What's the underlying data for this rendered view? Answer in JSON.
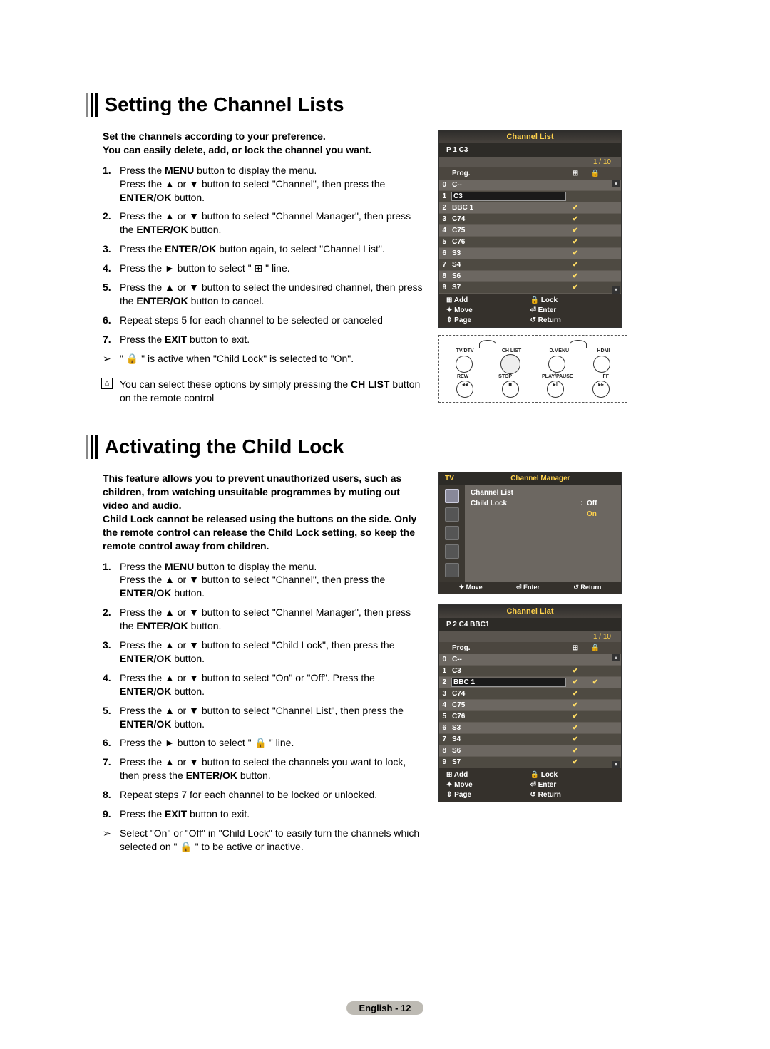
{
  "section1": {
    "title": "Setting the Channel Lists",
    "intro1": "Set the channels according to your preference.",
    "intro2": "You can easily delete, add, or lock the channel you want.",
    "s1a": "Press the ",
    "s1b": "MENU",
    "s1c": " button to display the menu.",
    "s1d": "Press the ▲ or ▼ button to select \"Channel\", then press the ",
    "s1e": "ENTER/OK",
    "s1f": " button.",
    "s2a": "Press the ▲ or ▼ button to select \"Channel Manager\", then press the ",
    "s2b": "ENTER/OK",
    "s2c": " button.",
    "s3a": "Press the ",
    "s3b": "ENTER/OK",
    "s3c": " button again, to select \"Channel List\".",
    "s4a": "Press the ► button to select \" ⊞ \" line.",
    "s5a": "Press the ▲ or ▼ button to select the undesired channel, then press the ",
    "s5b": "ENTER/OK",
    "s5c": " button to cancel.",
    "s6": "Repeat steps 5 for each channel to be selected or canceled",
    "s7a": "Press the ",
    "s7b": "EXIT",
    "s7c": " button to exit.",
    "note": "\" 🔒 \" is active when \"Child Lock\" is selected to \"On\".",
    "tipA": "You can select these options by simply pressing the ",
    "tipB": "CH LIST",
    "tipC": " button on the remote control"
  },
  "osd1": {
    "title": "Channel List",
    "sub": "P  1  C3",
    "counter": "1 / 10",
    "head_prog": "Prog.",
    "rows": [
      {
        "n": "0",
        "name": "C--",
        "add": "",
        "lock": ""
      },
      {
        "n": "1",
        "name": "C3",
        "add": "",
        "lock": ""
      },
      {
        "n": "2",
        "name": "BBC 1",
        "add": "✔",
        "lock": ""
      },
      {
        "n": "3",
        "name": "C74",
        "add": "✔",
        "lock": ""
      },
      {
        "n": "4",
        "name": "C75",
        "add": "✔",
        "lock": ""
      },
      {
        "n": "5",
        "name": "C76",
        "add": "✔",
        "lock": ""
      },
      {
        "n": "6",
        "name": "S3",
        "add": "✔",
        "lock": ""
      },
      {
        "n": "7",
        "name": "S4",
        "add": "✔",
        "lock": ""
      },
      {
        "n": "8",
        "name": "S6",
        "add": "✔",
        "lock": ""
      },
      {
        "n": "9",
        "name": "S7",
        "add": "✔",
        "lock": ""
      }
    ],
    "f_add": "⊞ Add",
    "f_lock": "🔒 Lock",
    "f_move": "✦ Move",
    "f_enter": "⏎ Enter",
    "f_page": "⇕ Page",
    "f_return": "↺ Return",
    "selected_row": 1
  },
  "remote": {
    "l1": [
      "TV/DTV",
      "CH LIST",
      "D.MENU",
      "HDMI"
    ],
    "l2": [
      "REW",
      "STOP",
      "PLAY/PAUSE",
      "FF"
    ]
  },
  "section2": {
    "title": "Activating the Child Lock",
    "intro1": "This feature allows you to prevent unauthorized users, such as children, from watching unsuitable programmes by muting out video and audio.",
    "intro2": "Child Lock cannot be released using the buttons on the side. Only the remote control can release the Child Lock setting, so keep the remote control away from children.",
    "s1a": "Press the ",
    "s1b": "MENU",
    "s1c": " button to display the menu.",
    "s1d": "Press the ▲ or ▼ button to select \"Channel\", then press the ",
    "s1e": "ENTER/OK",
    "s1f": " button.",
    "s2a": "Press the ▲ or ▼ button to select \"Channel Manager\", then press the ",
    "s2b": "ENTER/OK",
    "s2c": " button.",
    "s3a": "Press the ▲ or ▼ button to select \"Child Lock\", then press the ",
    "s3b": "ENTER/OK",
    "s3c": " button.",
    "s4a": "Press the ▲ or ▼ button to select \"On\" or \"Off\". Press the ",
    "s4b": "ENTER/OK",
    "s4c": " button.",
    "s5a": "Press the ▲ or ▼ button to select \"Channel List\", then press the ",
    "s5b": "ENTER/OK",
    "s5c": " button.",
    "s6": "Press the ► button to select \" 🔒 \" line.",
    "s7a": "Press the ▲ or ▼ button to select the channels you want to lock, then press the ",
    "s7b": "ENTER/OK",
    "s7c": " button.",
    "s8": "Repeat steps 7 for each channel to be locked or unlocked.",
    "s9a": "Press the ",
    "s9b": "EXIT",
    "s9c": " button to exit.",
    "note": "Select \"On\" or \"Off\" in \"Child Lock\" to easily turn the channels which selected on \" 🔒 \" to be active or inactive."
  },
  "osd_cm": {
    "tv": "TV",
    "title": "Channel Manager",
    "m1": "Channel List",
    "m2k": "Child Lock",
    "m2sep": ":",
    "m2v_off": "Off",
    "m2v_on": "On",
    "f_move": "✦ Move",
    "f_enter": "⏎ Enter",
    "f_return": "↺ Return"
  },
  "osd2": {
    "title": "Channel Liat",
    "sub": "P  2  C4      BBC1",
    "counter": "1 / 10",
    "head_prog": "Prog.",
    "rows": [
      {
        "n": "0",
        "name": "C--",
        "add": "",
        "lock": ""
      },
      {
        "n": "1",
        "name": "C3",
        "add": "✔",
        "lock": ""
      },
      {
        "n": "2",
        "name": "BBC 1",
        "add": "✔",
        "lock": "✔"
      },
      {
        "n": "3",
        "name": "C74",
        "add": "✔",
        "lock": ""
      },
      {
        "n": "4",
        "name": "C75",
        "add": "✔",
        "lock": ""
      },
      {
        "n": "5",
        "name": "C76",
        "add": "✔",
        "lock": ""
      },
      {
        "n": "6",
        "name": "S3",
        "add": "✔",
        "lock": ""
      },
      {
        "n": "7",
        "name": "S4",
        "add": "✔",
        "lock": ""
      },
      {
        "n": "8",
        "name": "S6",
        "add": "✔",
        "lock": ""
      },
      {
        "n": "9",
        "name": "S7",
        "add": "✔",
        "lock": ""
      }
    ],
    "f_add": "⊞ Add",
    "f_lock": "🔒 Lock",
    "f_move": "✦ Move",
    "f_enter": "⏎ Enter",
    "f_page": "⇕ Page",
    "f_return": "↺ Return",
    "selected_row": 2
  },
  "footer": "English - 12"
}
